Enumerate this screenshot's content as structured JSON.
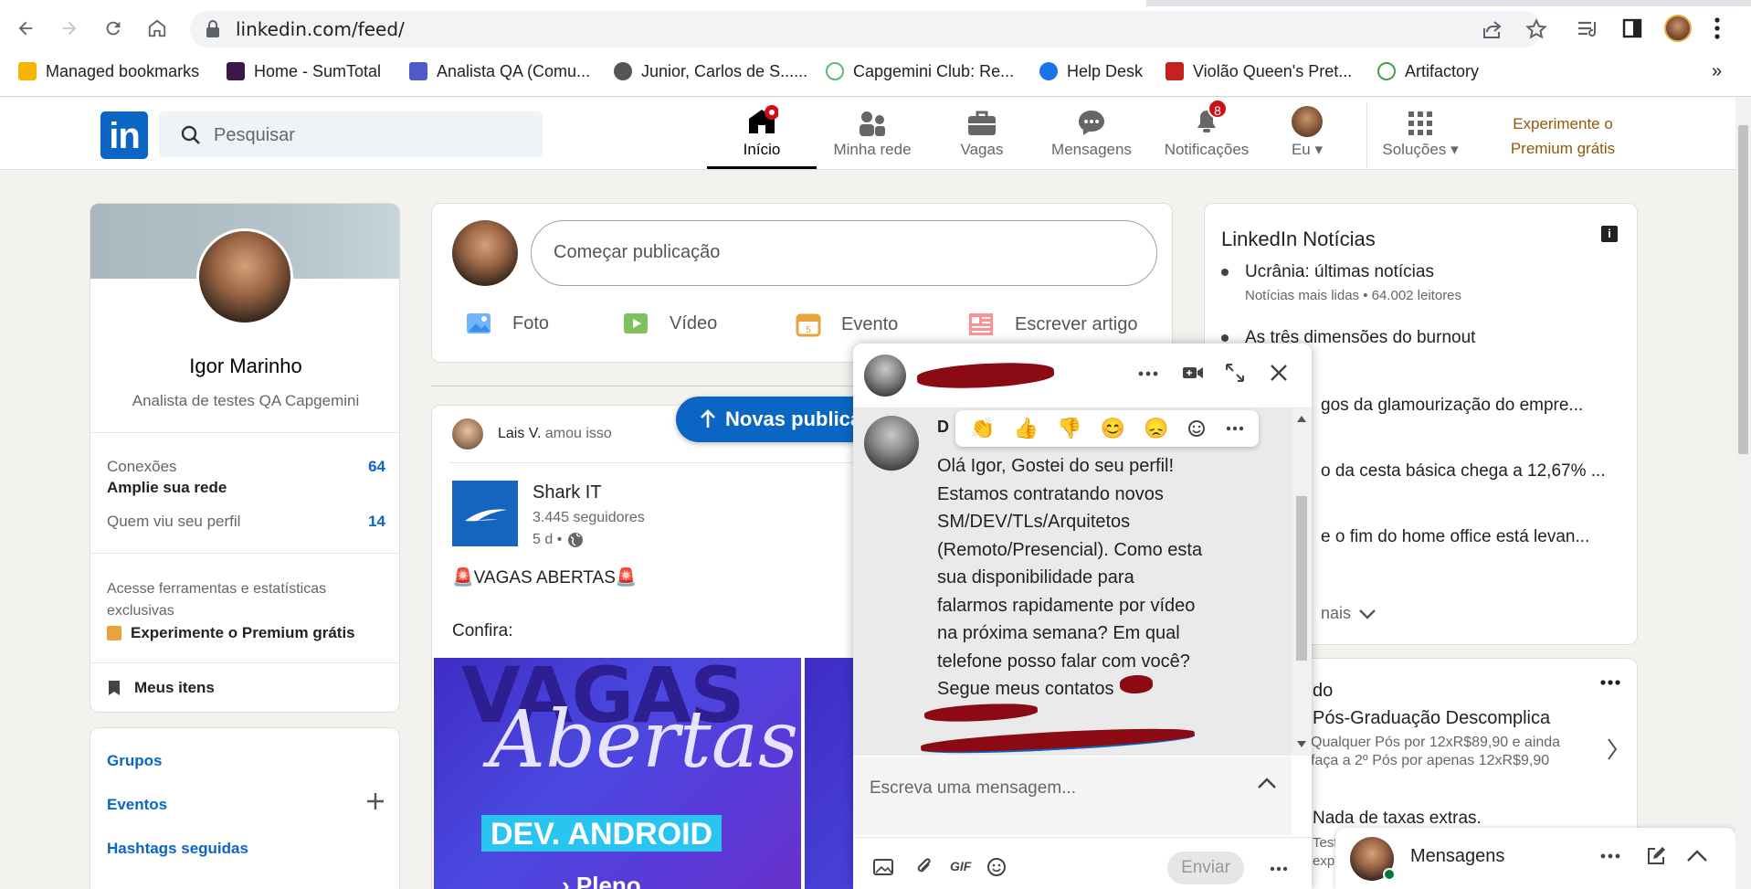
{
  "browser": {
    "url": "linkedin.com/feed/",
    "bookmarks": [
      {
        "label": "Managed bookmarks",
        "color": "#f5b400"
      },
      {
        "label": "Home - SumTotal",
        "color": "#3b1a4a"
      },
      {
        "label": "Analista QA (Comu...",
        "color": "#5059c9"
      },
      {
        "label": "Junior, Carlos de S......",
        "color": "#555555"
      },
      {
        "label": "Capgemini Club: Re...",
        "color": "#5bb974"
      },
      {
        "label": "Help Desk",
        "color": "#1a73e8"
      },
      {
        "label": "Violão Queen's Pret...",
        "color": "#c5221f"
      },
      {
        "label": "Artifactory",
        "color": "#43a047"
      }
    ],
    "more_bookmarks": "»"
  },
  "linkedin": {
    "logo": "in",
    "search_placeholder": "Pesquisar",
    "nav": {
      "home": "Início",
      "network": "Minha rede",
      "jobs": "Vagas",
      "messaging": "Mensagens",
      "notifications": "Notificações",
      "notifications_badge": "8",
      "me": "Eu",
      "solutions": "Soluções",
      "premium_line1": "Experimente o",
      "premium_line2": "Premium grátis"
    },
    "brand_color": "#0a66c2"
  },
  "profile": {
    "name": "Igor Marinho",
    "headline": "Analista de testes QA Capgemini",
    "connections_label": "Conexões",
    "connections_sub": "Amplie sua rede",
    "connections_count": "64",
    "viewers_label": "Quem viu seu perfil",
    "viewers_count": "14",
    "premium_text": "Acesse ferramentas e estatísticas exclusivas",
    "premium_link": "Experimente o Premium grátis",
    "saved": "Meus itens"
  },
  "sidebar_links": {
    "groups": "Grupos",
    "events": "Eventos",
    "hashtags": "Hashtags seguidas"
  },
  "composer": {
    "placeholder": "Começar publicação",
    "photo": "Foto",
    "video": "Vídeo",
    "event": "Evento",
    "article": "Escrever artigo"
  },
  "feed": {
    "new_posts_pill": "Novas publicações",
    "liked_by": "Lais V.",
    "liked_suffix": "amou isso",
    "company": "Shark IT",
    "followers": "3.445 seguidores",
    "age": "5 d •",
    "post_title": "🚨VAGAS ABERTAS🚨",
    "post_sub": "Confira:",
    "image_text_1": "VAGAS",
    "image_text_2": "Abertas",
    "image_role": "DEV. ANDROID",
    "image_level": "› Pleno"
  },
  "news": {
    "title": "LinkedIn Notícias",
    "items": [
      {
        "headline": "Ucrânia: últimas notícias",
        "sub": "Notícias mais lidas • 64.002 leitores"
      },
      {
        "headline": "As três dimensões do burnout",
        "sub": ""
      },
      {
        "headline": "gos da glamourização do empre...",
        "sub": ""
      },
      {
        "headline": "o da cesta básica chega a 12,67% ...",
        "sub": ""
      },
      {
        "headline": "e o fim do home office está levan...",
        "sub": ""
      }
    ],
    "show_more": "nais"
  },
  "ad": {
    "header": "do",
    "title": "Pós-Graduação Descomplica",
    "line1": "Qualquer Pós por 12xR$89,90 e ainda",
    "line2": "faça a 2º Pós por apenas 12xR$9,90",
    "extra": "Nada de taxas extras.",
    "footer1": "Test",
    "footer2": "exp"
  },
  "chat": {
    "sender_initial": "D",
    "message_lines": [
      "Olá Igor, Gostei do seu perfil!",
      "Estamos contratando novos",
      "SM/DEV/TLs/Arquitetos",
      "(Remoto/Presencial). Como esta",
      "sua disponibilidade para",
      "falarmos rapidamente por vídeo",
      "na próxima semana? Em qual",
      "telefone posso falar com você?",
      "Segue meus contatos"
    ],
    "input_placeholder": "Escreva uma mensagem...",
    "send": "Enviar",
    "gif": "GIF"
  },
  "messaging_bar": {
    "label": "Mensagens"
  }
}
